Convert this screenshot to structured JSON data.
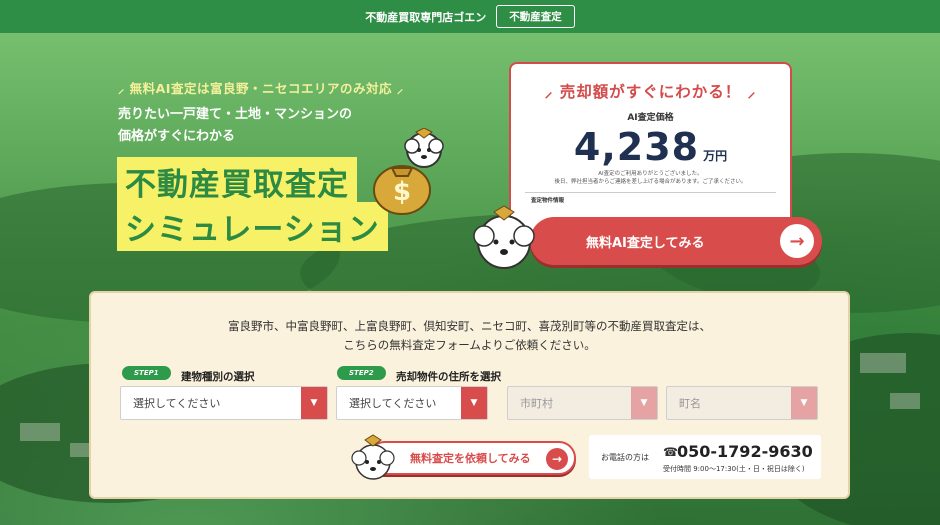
{
  "header": {
    "brand": "不動産買取専門店ゴエン",
    "nav_button": "不動産査定"
  },
  "hero": {
    "tagline": "無料AI査定は富良野・ニセコエリアのみ対応",
    "subtitle_line1": "売りたい一戸建て・土地・マンションの",
    "subtitle_line2": "価格がすぐにわかる",
    "headline_line1": "不動産買取査定",
    "headline_line2": "シミュレーション"
  },
  "result_card": {
    "title": "売却額がすぐにわかる！",
    "label": "AI査定価格",
    "price": "4,238",
    "unit": "万円",
    "note_line1": "AI査定のご利用ありがとうございました。",
    "note_line2": "後日、弊社担当者からご連絡を差し上げる場合があります。ご了承ください。",
    "info_label": "査定物件情報"
  },
  "cta_main": {
    "label": "無料AI査定してみる",
    "arrow": "→"
  },
  "form": {
    "intro_line1": "富良野市、中富良野町、上富良野町、倶知安町、ニセコ町、喜茂別町等の不動産買取査定は、",
    "intro_line2": "こちらの無料査定フォームよりご依頼ください。",
    "step1": {
      "badge": "STEP1",
      "label": "建物種別の選択",
      "value": "選択してください"
    },
    "step2": {
      "badge": "STEP2",
      "label": "売却物件の住所を選択",
      "value": "選択してください"
    },
    "city": {
      "value": "市町村"
    },
    "town": {
      "value": "町名"
    },
    "caret": "▼",
    "submit": {
      "label": "無料査定を依頼してみる",
      "arrow": "→"
    },
    "phone": {
      "lead": "お電話の方は",
      "icon": "☎",
      "number": "050-1792-9630",
      "hours": "受付時間 9:00〜17:30(土・日・祝日は除く)"
    }
  },
  "colors": {
    "brand_green": "#2f8e45",
    "accent_red": "#d94c4c",
    "highlight_yellow": "#f7f167",
    "panel_cream": "#fbf2dd"
  }
}
